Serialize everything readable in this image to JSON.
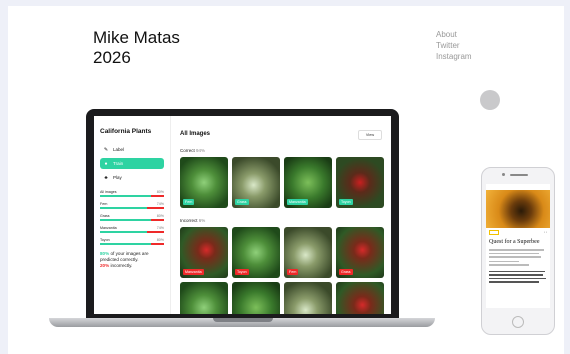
{
  "site": {
    "name": "Mike Matas",
    "year": "2026"
  },
  "nav": [
    "About",
    "Twitter",
    "Instagram"
  ],
  "app": {
    "title": "California Plants",
    "menu": [
      {
        "label": "Label",
        "icon": "edit-icon",
        "active": false
      },
      {
        "label": "Train",
        "icon": "train-icon",
        "active": true
      },
      {
        "label": "Play",
        "icon": "play-icon",
        "active": false
      }
    ],
    "stats": [
      {
        "label": "All images",
        "pct": "80%",
        "value": 0.8
      },
      {
        "label": "Fern",
        "pct": "74%",
        "value": 0.74
      },
      {
        "label": "Grass",
        "pct": "80%",
        "value": 0.8
      },
      {
        "label": "Manzanita",
        "pct": "74%",
        "value": 0.74
      },
      {
        "label": "Toyon",
        "pct": "80%",
        "value": 0.8
      }
    ],
    "summary": {
      "pct_correct": "80%",
      "text1": " of your images are predicted correctly.",
      "pct_incorrect": "20%",
      "text2": " incorrectly."
    },
    "main_title": "All Images",
    "view_button": "View",
    "correct": {
      "label": "Correct",
      "count": "94%",
      "images": [
        {
          "tag": "Fern",
          "kind": "fern"
        },
        {
          "tag": "Grass",
          "kind": "manzanita"
        },
        {
          "tag": "Manzanita",
          "kind": "grass"
        },
        {
          "tag": "Toyon",
          "kind": "toyon"
        }
      ]
    },
    "incorrect": {
      "label": "Incorrect",
      "count": "6%",
      "images": [
        {
          "tag": "Manzanita",
          "kind": "berry"
        },
        {
          "tag": "Toyon",
          "kind": "fern"
        },
        {
          "tag": "Fern",
          "kind": "manzanita"
        },
        {
          "tag": "Grass",
          "kind": "berry"
        }
      ]
    },
    "colors": {
      "accent": "#2ed3a2",
      "error": "#ee2a2a"
    }
  },
  "phone": {
    "article_title": "Quest for a Superbee"
  }
}
